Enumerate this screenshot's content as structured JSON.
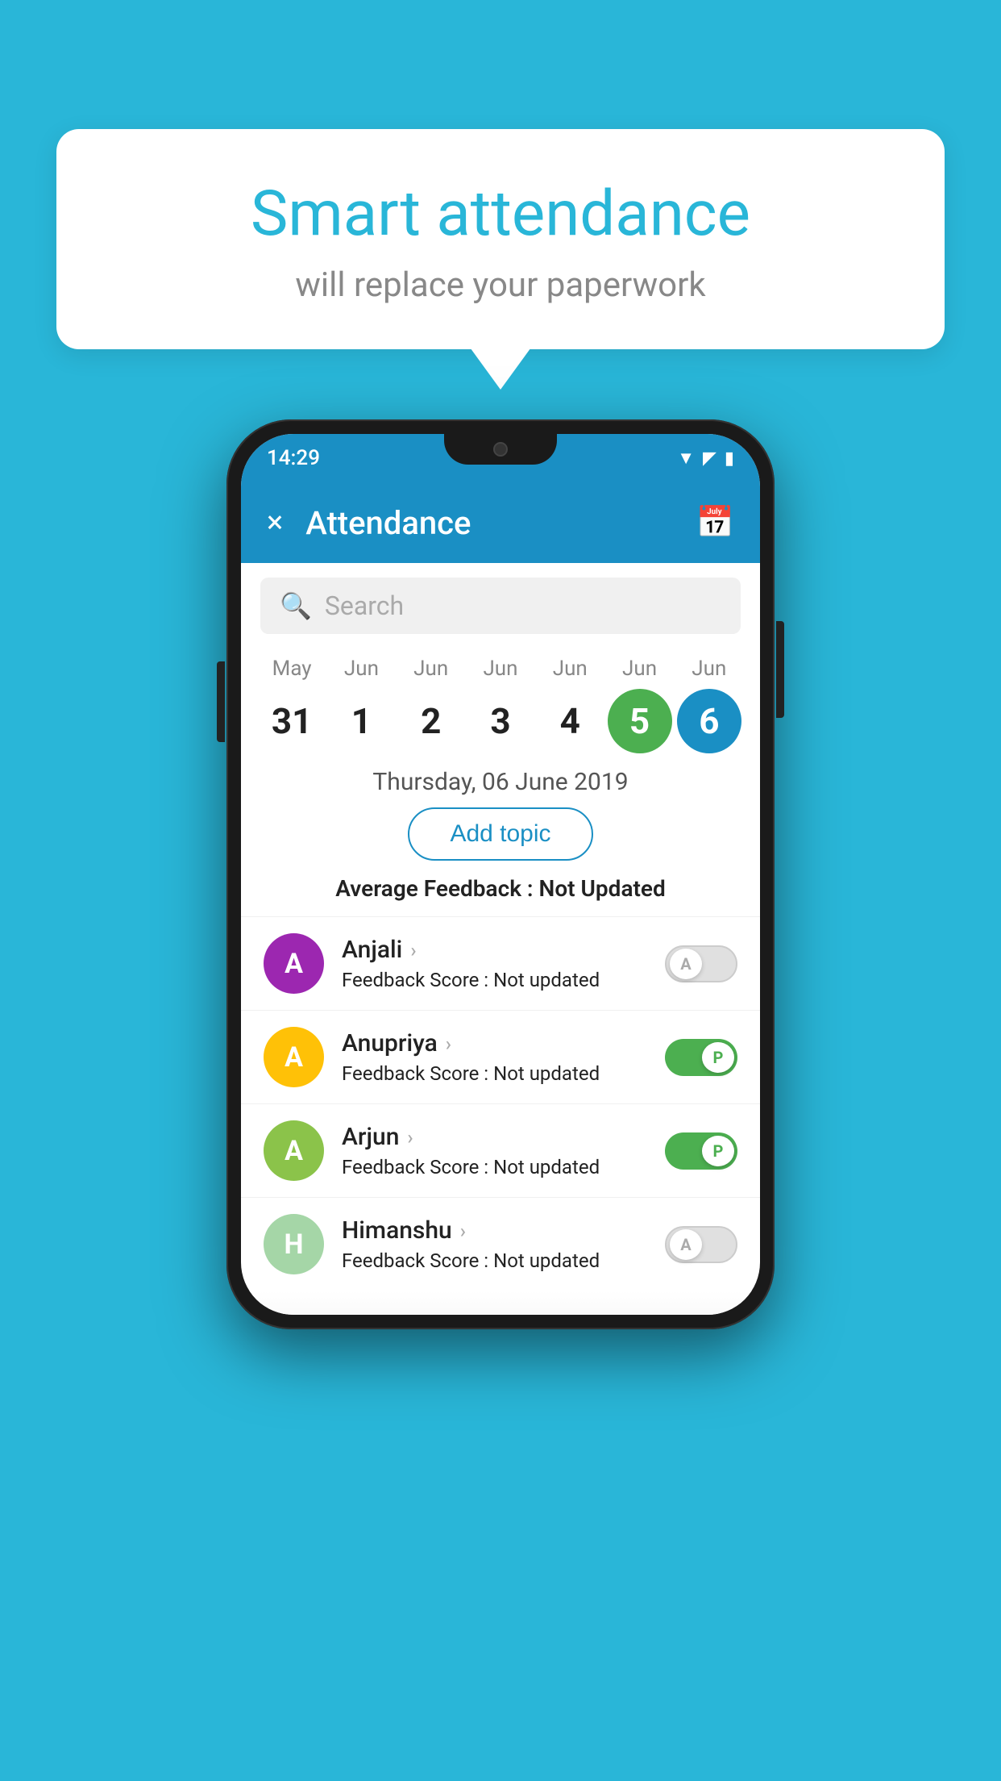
{
  "background_color": "#29b6d8",
  "speech_bubble": {
    "title": "Smart attendance",
    "subtitle": "will replace your paperwork"
  },
  "status_bar": {
    "time": "14:29",
    "icons": [
      "wifi",
      "signal",
      "battery"
    ]
  },
  "app_bar": {
    "title": "Attendance",
    "close_label": "×",
    "calendar_icon": "📅"
  },
  "search": {
    "placeholder": "Search"
  },
  "calendar": {
    "days": [
      {
        "month": "May",
        "date": "31",
        "style": "normal"
      },
      {
        "month": "Jun",
        "date": "1",
        "style": "normal"
      },
      {
        "month": "Jun",
        "date": "2",
        "style": "normal"
      },
      {
        "month": "Jun",
        "date": "3",
        "style": "normal"
      },
      {
        "month": "Jun",
        "date": "4",
        "style": "normal"
      },
      {
        "month": "Jun",
        "date": "5",
        "style": "green"
      },
      {
        "month": "Jun",
        "date": "6",
        "style": "blue"
      }
    ]
  },
  "selected_date": "Thursday, 06 June 2019",
  "add_topic_label": "Add topic",
  "avg_feedback_label": "Average Feedback :",
  "avg_feedback_value": "Not Updated",
  "students": [
    {
      "name": "Anjali",
      "avatar_letter": "A",
      "avatar_color": "#9c27b0",
      "feedback_label": "Feedback Score :",
      "feedback_value": "Not updated",
      "toggle": "off",
      "toggle_letter": "A"
    },
    {
      "name": "Anupriya",
      "avatar_letter": "A",
      "avatar_color": "#ffc107",
      "feedback_label": "Feedback Score :",
      "feedback_value": "Not updated",
      "toggle": "on",
      "toggle_letter": "P"
    },
    {
      "name": "Arjun",
      "avatar_letter": "A",
      "avatar_color": "#8bc34a",
      "feedback_label": "Feedback Score :",
      "feedback_value": "Not updated",
      "toggle": "on",
      "toggle_letter": "P"
    },
    {
      "name": "Himanshu",
      "avatar_letter": "H",
      "avatar_color": "#a5d6a7",
      "feedback_label": "Feedback Score :",
      "feedback_value": "Not updated",
      "toggle": "off",
      "toggle_letter": "A"
    }
  ]
}
